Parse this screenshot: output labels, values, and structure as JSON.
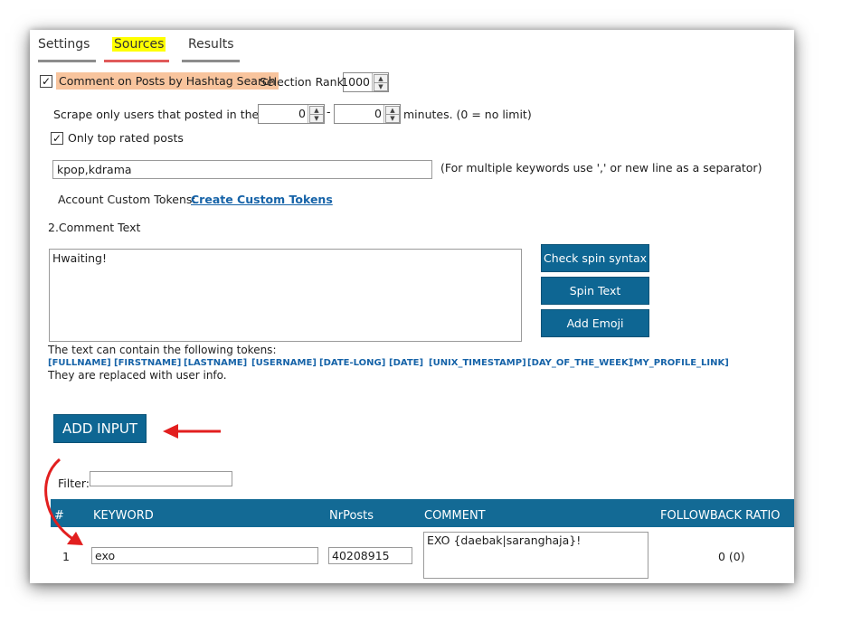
{
  "tabs": [
    {
      "label": "Settings",
      "underline": "#8c8c8c"
    },
    {
      "label": "Sources",
      "highlight": "#ffff00",
      "underline": "#e05a5a"
    },
    {
      "label": "Results",
      "underline": "#8c8c8c"
    }
  ],
  "hashtag": {
    "checkbox_label": "Comment on Posts by Hashtag Search",
    "checked": true,
    "label_bg": "#f8c49d",
    "rank_label": "Selection Rank",
    "rank_value": "1000"
  },
  "scrape": {
    "label": "Scrape only users that posted in the last",
    "from_value": "0",
    "dash": "-",
    "to_value": "0",
    "suffix": "minutes. (0 = no limit)"
  },
  "top_rated": {
    "label": "Only top rated posts",
    "checked": true
  },
  "keywords": {
    "value": "kpop,kdrama",
    "hint": "(For multiple keywords use ',' or new line as a separator)"
  },
  "custom_tokens": {
    "label": "Account Custom Tokens:",
    "link": "Create Custom Tokens"
  },
  "comment": {
    "section_label": "2.Comment Text",
    "value": "Hwaiting!",
    "buttons": [
      "Check spin syntax",
      "Spin Text",
      "Add Emoji"
    ],
    "tokens_intro": "The text can contain the following tokens:",
    "tokens": [
      "[FULLNAME]",
      "[FIRSTNAME]",
      "[LASTNAME]",
      "[USERNAME]",
      "[DATE-LONG]",
      "[DATE]",
      "[UNIX_TIMESTAMP]",
      "[DAY_OF_THE_WEEK]",
      "[MY_PROFILE_LINK]"
    ],
    "tokens_outro": "They are replaced with user info."
  },
  "add_input": {
    "label": "ADD INPUT"
  },
  "filter": {
    "label": "Filter:",
    "value": ""
  },
  "table": {
    "headers": [
      "#",
      "KEYWORD",
      "NrPosts",
      "COMMENT",
      "FOLLOWBACK RATIO"
    ],
    "header_bg": "#136a95",
    "rows": [
      {
        "num": "1",
        "keyword": "exo",
        "nrposts": "40208915",
        "comment": "EXO {daebak|saranghaja}!",
        "ratio": "0 (0)"
      }
    ]
  },
  "colors": {
    "accent": "#0e6693",
    "link": "#1663a8",
    "arrow": "#e21f1f"
  },
  "annotations": {
    "arrow_icons": [
      "arrow-left-icon",
      "curved-arrow-down-icon"
    ]
  }
}
